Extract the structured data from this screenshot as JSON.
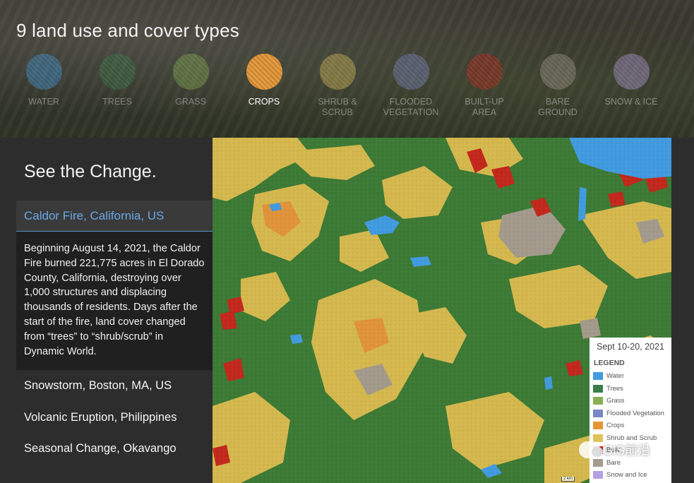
{
  "header": {
    "title": "9 land use and cover types",
    "types": [
      {
        "label": "WATER",
        "color": "#419bdf",
        "active": false
      },
      {
        "label": "TREES",
        "color": "#397d49",
        "active": false
      },
      {
        "label": "GRASS",
        "color": "#88b053",
        "active": false
      },
      {
        "label": "CROPS",
        "color": "#e49635",
        "active": true
      },
      {
        "label": "SHRUB &\nSCRUB",
        "color": "#dfc35a",
        "active": false
      },
      {
        "label": "FLOODED\nVEGETATION",
        "color": "#7a87c6",
        "active": false
      },
      {
        "label": "BUILT-UP\nAREA",
        "color": "#c4281b",
        "active": false
      },
      {
        "label": "BARE\nGROUND",
        "color": "#a59b8f",
        "active": false
      },
      {
        "label": "SNOW & ICE",
        "color": "#b39fe1",
        "active": false
      }
    ]
  },
  "panel": {
    "section_title": "See the Change.",
    "active_story": {
      "title": "Caldor Fire, California, US",
      "body": "Beginning August 14, 2021, the Caldor Fire burned 221,775 acres in El Dorado County, California, destroying over 1,000 structures and displacing thousands of residents. Days after the start of the fire, land cover changed from “trees” to “shrub/scrub” in Dynamic World."
    },
    "stories": [
      {
        "title": "Snowstorm, Boston, MA, US"
      },
      {
        "title": "Volcanic Eruption, Philippines"
      },
      {
        "title": "Seasonal Change, Okavango"
      }
    ]
  },
  "map": {
    "legend": {
      "date": "Sept 10-20, 2021",
      "heading": "LEGEND",
      "items": [
        {
          "label": "Water",
          "color": "#419bdf"
        },
        {
          "label": "Trees",
          "color": "#397d49"
        },
        {
          "label": "Grass",
          "color": "#88b053"
        },
        {
          "label": "Flooded Vegetation",
          "color": "#7a87c6"
        },
        {
          "label": "Crops",
          "color": "#e49635"
        },
        {
          "label": "Shrub and Scrub",
          "color": "#dfc35a"
        },
        {
          "label": "Built",
          "color": "#c4281b"
        },
        {
          "label": "Bare",
          "color": "#a59b8f"
        },
        {
          "label": "Snow and Ice",
          "color": "#b39fe1"
        }
      ]
    },
    "scale_label": "2 km"
  },
  "watermark": {
    "text": "GIS前沿"
  }
}
